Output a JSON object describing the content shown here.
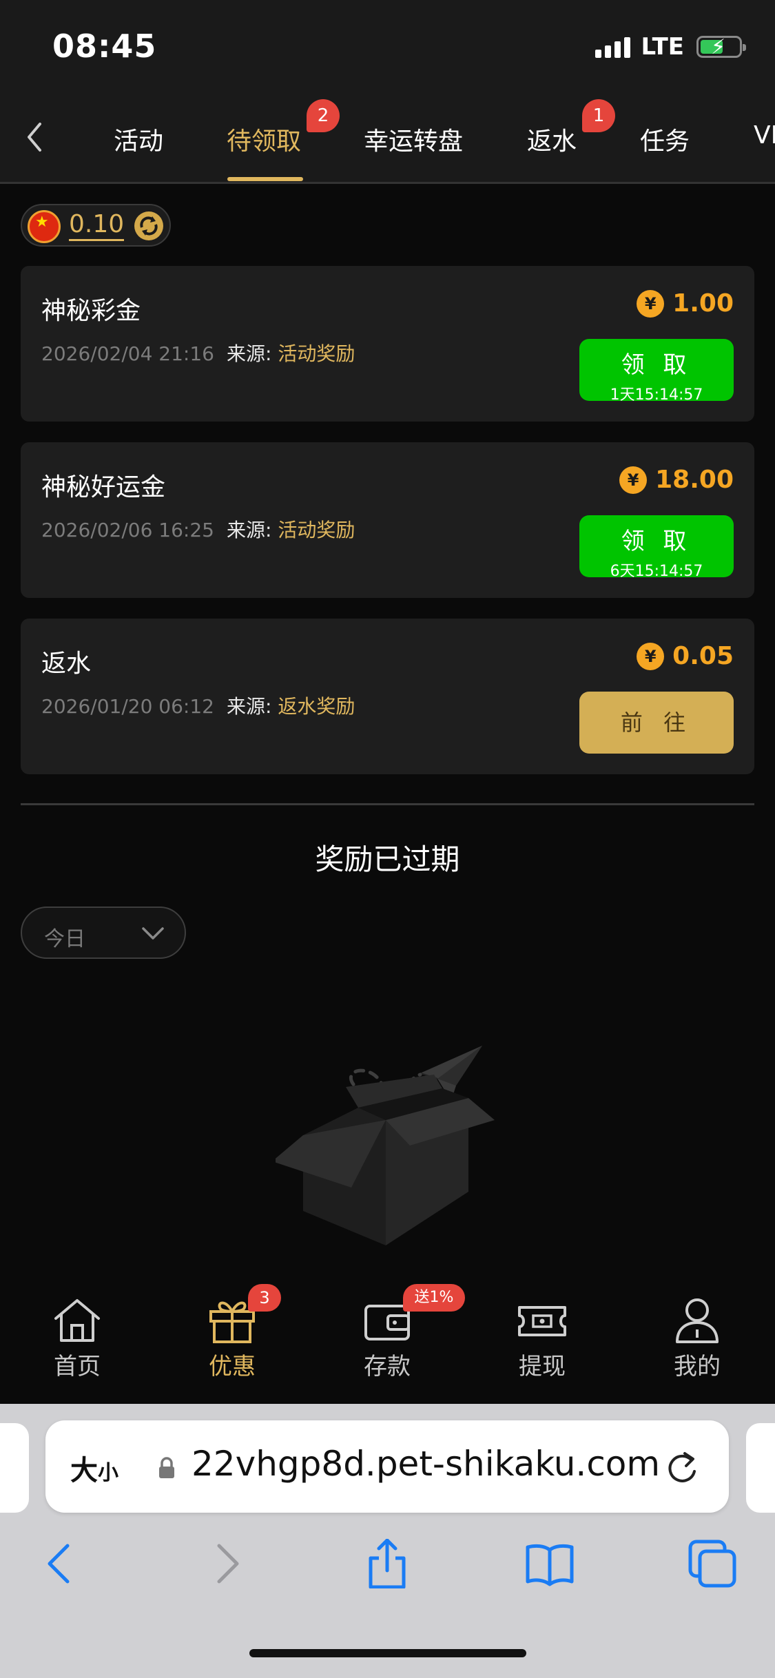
{
  "status_bar": {
    "time": "08:45",
    "network": "LTE"
  },
  "tabs": [
    {
      "label": "活动",
      "active": false
    },
    {
      "label": "待领取",
      "active": true,
      "badge": "2"
    },
    {
      "label": "幸运转盘",
      "active": false
    },
    {
      "label": "返水",
      "active": false,
      "badge": "1"
    },
    {
      "label": "任务",
      "active": false
    },
    {
      "label": "VI",
      "active": false
    }
  ],
  "balance": {
    "amount": "0.10"
  },
  "rewards": [
    {
      "title": "神秘彩金",
      "date": "2026/02/04 21:16",
      "source_label": "来源:",
      "source": "活动奖励",
      "amount": "1.00",
      "action": "领 取",
      "timer": "1天15:14:57"
    },
    {
      "title": "神秘好运金",
      "date": "2026/02/06 16:25",
      "source_label": "来源:",
      "source": "活动奖励",
      "amount": "18.00",
      "action": "领 取",
      "timer": "6天15:14:57"
    },
    {
      "title": "返水",
      "date": "2026/01/20 06:12",
      "source_label": "来源:",
      "source": "返水奖励",
      "amount": "0.05",
      "action": "前 往"
    }
  ],
  "currency_symbol": "¥",
  "expired": {
    "title": "奖励已过期",
    "filter_value": "今日"
  },
  "bottom_nav": [
    {
      "label": "首页",
      "icon": "home-icon",
      "active": false
    },
    {
      "label": "优惠",
      "icon": "gift-icon",
      "active": true,
      "badge": "3"
    },
    {
      "label": "存款",
      "icon": "wallet-icon",
      "active": false,
      "badge": "送1%"
    },
    {
      "label": "提现",
      "icon": "withdraw-icon",
      "active": false
    },
    {
      "label": "我的",
      "icon": "profile-icon",
      "active": false
    }
  ],
  "browser": {
    "text_size_label": "大",
    "text_size_small": "小",
    "url": "22vhgp8d.pet-shikaku.com"
  },
  "colors": {
    "accent": "#e0b75e",
    "claim_green": "#00c400",
    "amount_orange": "#f5a623",
    "badge_red": "#e5453c"
  }
}
